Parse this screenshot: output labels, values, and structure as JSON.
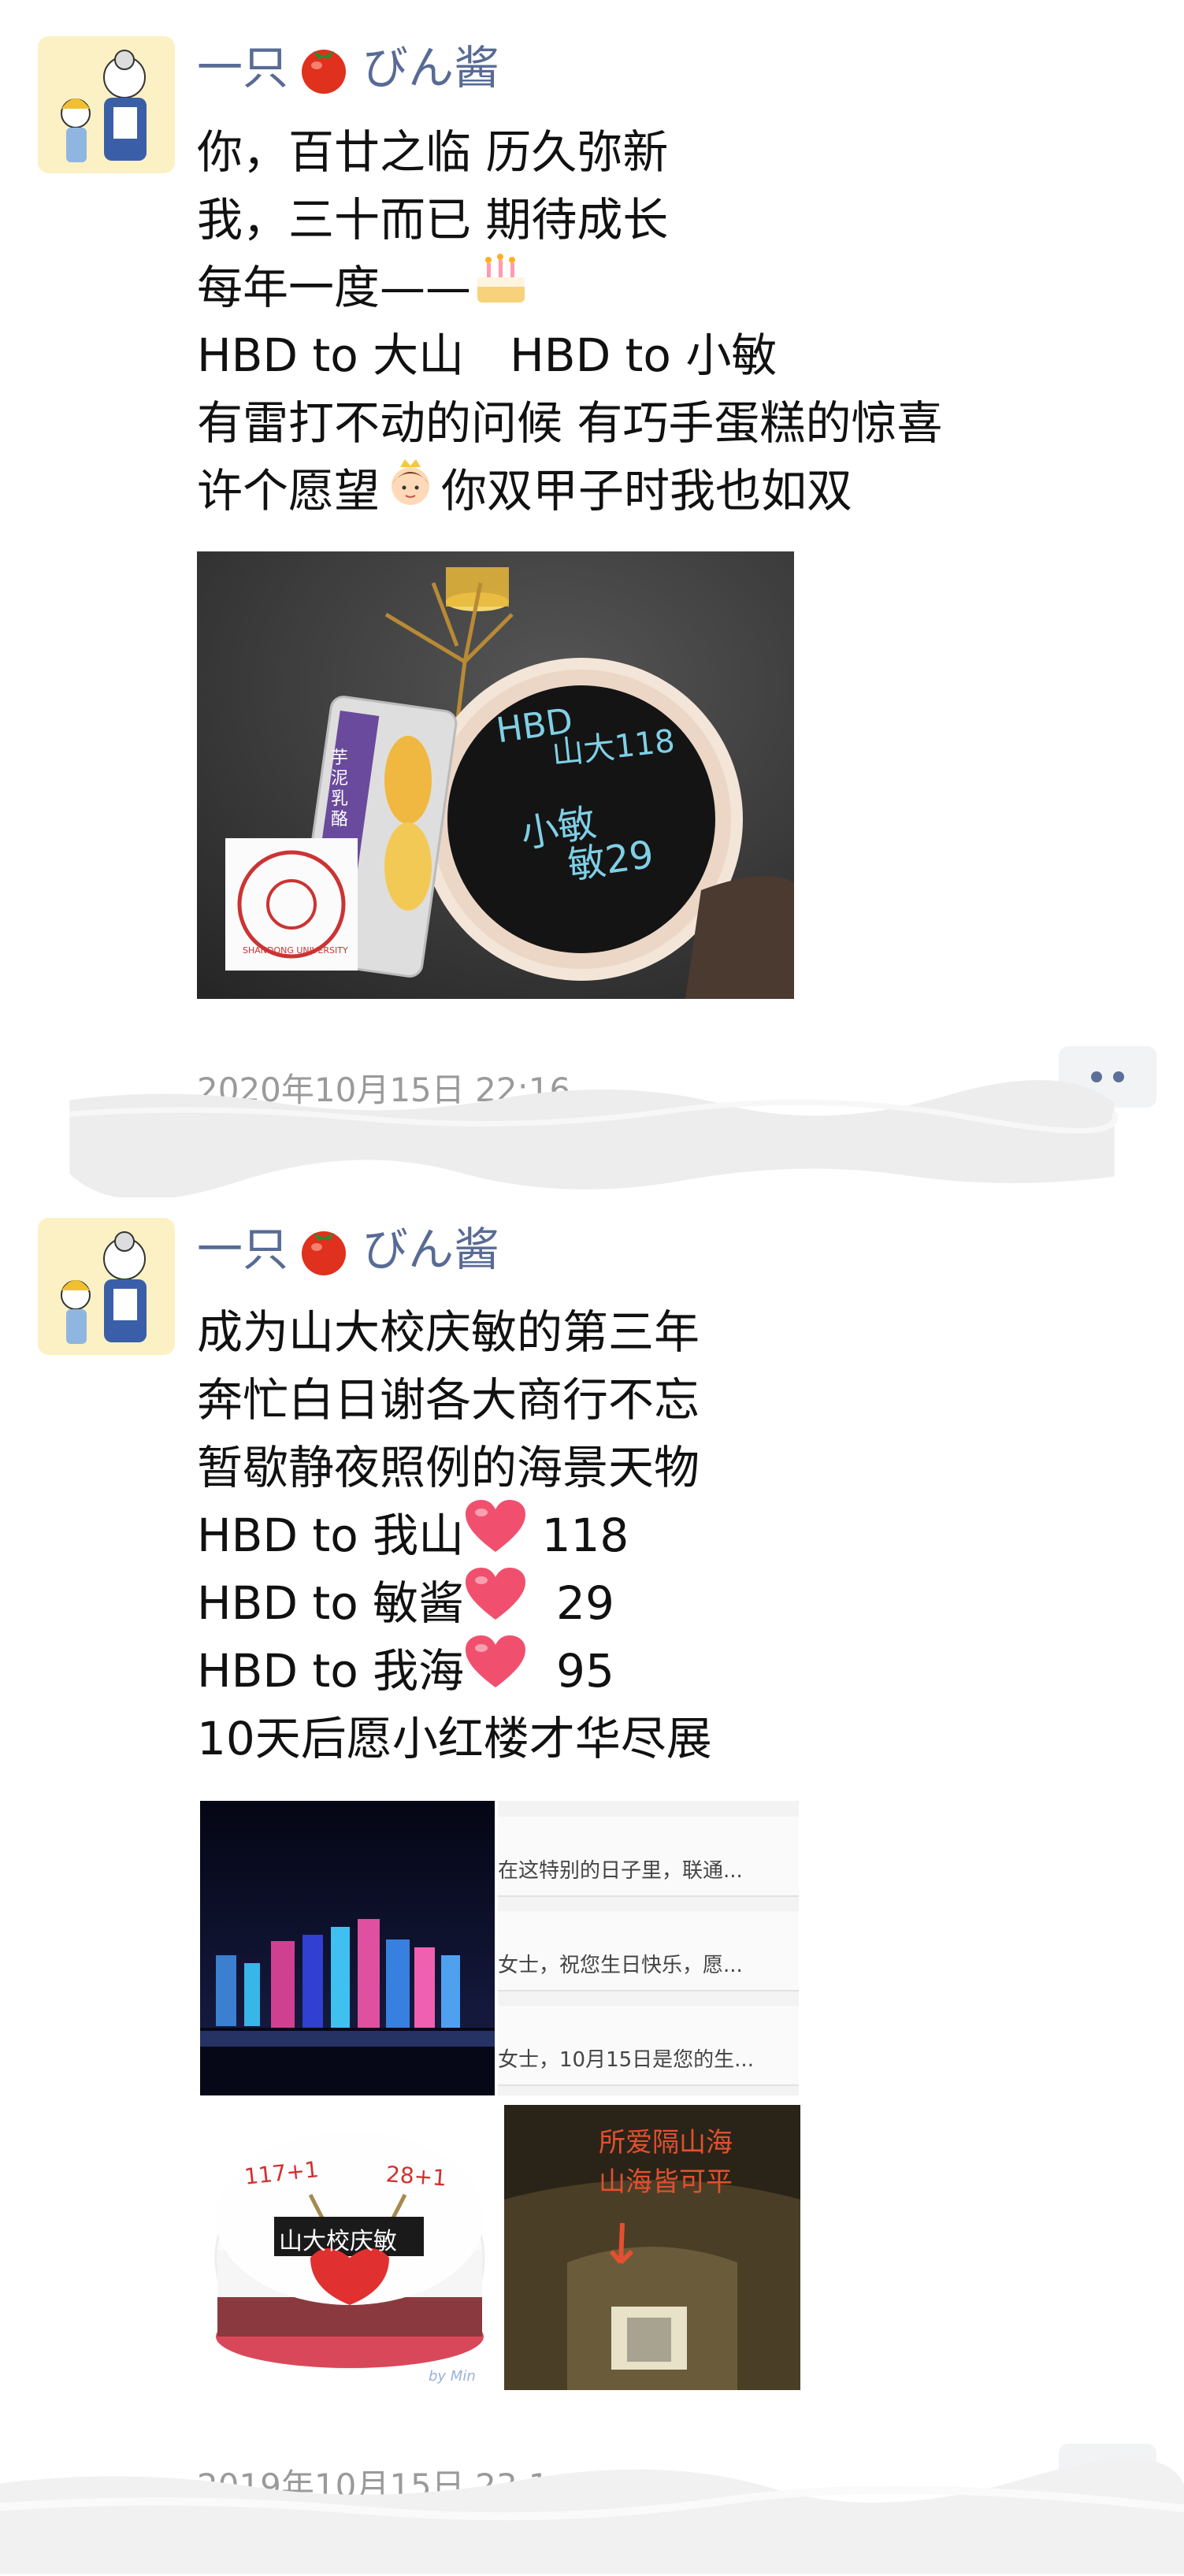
{
  "post1": {
    "nickname_a": "一只",
    "nickname_b": "びん酱",
    "lines": [
      {
        "t1": "你，百廿之临 历久弥新",
        "t2": ""
      },
      {
        "t1": "我，三十而已 期待成长",
        "t2": ""
      },
      {
        "t1": "每年一度——",
        "t2": ""
      },
      {
        "t1": "HBD to 大山　HBD to 小敏",
        "t2": ""
      },
      {
        "t1": "有雷打不动的问候 有巧手蛋糕的惊喜",
        "t2": ""
      },
      {
        "t1": "许个愿望",
        "t2": "你双甲子时我也如双"
      }
    ],
    "photo_cake_text_1": "HBD",
    "photo_cake_text_2": "山大118",
    "photo_cake_text_3": "小敏",
    "photo_cake_text_4": "敏29",
    "photo_box_label": "芋泥乳酪",
    "photo_stamp_text": "SHANDONG UNIVERSITY",
    "timestamp": "2020年10月15日 22:16"
  },
  "post2": {
    "nickname_a": "一只",
    "nickname_b": "びん酱",
    "lines": [
      {
        "a": "成为山大校庆敏的第三年",
        "b": ""
      },
      {
        "a": "奔忙白日谢各大商行不忘",
        "b": ""
      },
      {
        "a": "暂歇静夜照例的海景天物",
        "b": ""
      },
      {
        "a": "HBD to 我山",
        "b": " 118"
      },
      {
        "a": "HBD to 敏酱",
        "b": "  29"
      },
      {
        "a": "HBD to 我海",
        "b": "  95"
      },
      {
        "a": "10天后愿小红楼才华尽展",
        "b": ""
      }
    ],
    "sms_lines": [
      "在这特别的日子里，联通...",
      "女士，祝您生日快乐，愿...",
      "女士，10月15日是您的生..."
    ],
    "cake2_text_left": "117+1",
    "cake2_text_right": "28+1",
    "cake2_label": "山大校庆敏",
    "cake2_signature": "by Min",
    "tunnel_text_1": "所爱隔山海",
    "tunnel_text_2": "山海皆可平",
    "timestamp": "2019年10月15日 23:1"
  },
  "colors": {
    "nickname": "#586b95",
    "body_text": "#111111",
    "timestamp": "#9a9a9a",
    "heart": "#f0506e",
    "tomato": "#e0301e"
  },
  "icons": [
    "tomato-emoji",
    "cake-emoji",
    "princess-emoji",
    "heart-emoji",
    "more-dots-icon"
  ]
}
